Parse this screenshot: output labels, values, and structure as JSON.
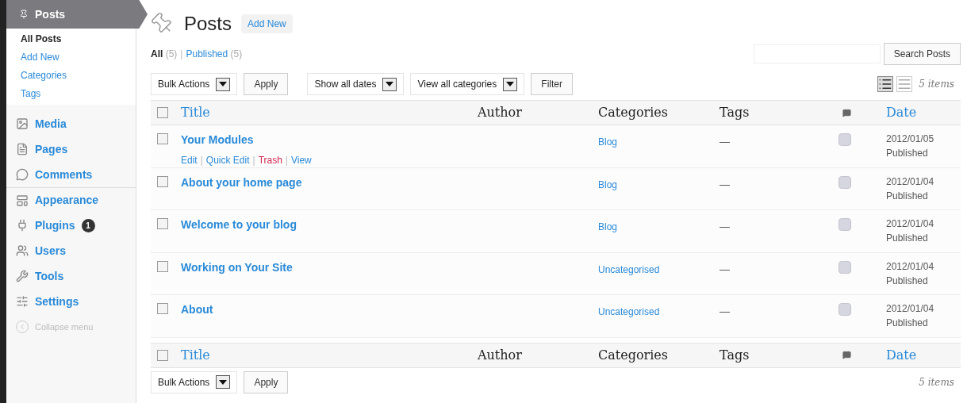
{
  "sidebar": {
    "current": {
      "label": "Posts"
    },
    "submenu": [
      {
        "label": "All Posts",
        "selected": true
      },
      {
        "label": "Add New",
        "selected": false
      },
      {
        "label": "Categories",
        "selected": false
      },
      {
        "label": "Tags",
        "selected": false
      }
    ],
    "items": [
      {
        "label": "Media"
      },
      {
        "label": "Pages"
      },
      {
        "label": "Comments"
      },
      {
        "label": "Appearance"
      },
      {
        "label": "Plugins",
        "badge": "1"
      },
      {
        "label": "Users"
      },
      {
        "label": "Tools"
      },
      {
        "label": "Settings"
      }
    ],
    "collapse": "Collapse menu"
  },
  "header": {
    "title": "Posts",
    "add_new": "Add New"
  },
  "filters": [
    {
      "label": "All",
      "count": "(5)",
      "selected": true
    },
    {
      "separator": "|",
      "label": "Published",
      "count": "(5)",
      "selected": false
    }
  ],
  "search": {
    "button": "Search Posts"
  },
  "toolbar": {
    "bulk": "Bulk Actions",
    "apply": "Apply",
    "dates": "Show all dates",
    "categories": "View all categories",
    "filter": "Filter"
  },
  "view_modes": [
    {
      "kind": "list",
      "selected": true
    },
    {
      "kind": "excerpt",
      "selected": false
    }
  ],
  "items_count": "5 items",
  "table_header": {
    "checked": false,
    "columns": [
      {
        "kind": "text",
        "label": "Title",
        "sortable": true
      },
      {
        "kind": "text",
        "label": "Author",
        "sortable": false
      },
      {
        "kind": "text",
        "label": "Categories",
        "sortable": false
      },
      {
        "kind": "text",
        "label": "Tags",
        "sortable": false
      },
      {
        "kind": "comments"
      },
      {
        "kind": "text",
        "label": "Date",
        "sortable": true
      }
    ]
  },
  "rows": [
    {
      "title": "Your Modules",
      "checked": false,
      "actions": [
        {
          "label": "Edit",
          "kind": "normal"
        },
        {
          "separator": "|",
          "label": "Quick Edit",
          "kind": "normal"
        },
        {
          "separator": "|",
          "label": "Trash",
          "kind": "danger"
        },
        {
          "separator": "|",
          "label": "View",
          "kind": "normal"
        }
      ],
      "category": "Blog",
      "tags": "—",
      "date": "2012/01/05",
      "status": "Published"
    },
    {
      "title": "About your home page",
      "checked": false,
      "category": "Blog",
      "tags": "—",
      "date": "2012/01/04",
      "status": "Published"
    },
    {
      "title": "Welcome to your blog",
      "checked": false,
      "category": "Blog",
      "tags": "—",
      "date": "2012/01/04",
      "status": "Published"
    },
    {
      "title": "Working on Your Site",
      "checked": false,
      "category": "Uncategorised",
      "tags": "—",
      "date": "2012/01/04",
      "status": "Published"
    },
    {
      "title": "About",
      "checked": false,
      "category": "Uncategorised",
      "tags": "—",
      "date": "2012/01/04",
      "status": "Published"
    }
  ],
  "table_footer": {
    "checked": false,
    "columns": [
      {
        "kind": "text",
        "label": "Title",
        "sortable": true
      },
      {
        "kind": "text",
        "label": "Author",
        "sortable": false
      },
      {
        "kind": "text",
        "label": "Categories",
        "sortable": false
      },
      {
        "kind": "text",
        "label": "Tags",
        "sortable": false
      },
      {
        "kind": "comments"
      },
      {
        "kind": "text",
        "label": "Date",
        "sortable": true
      }
    ]
  },
  "bottom_toolbar": {
    "bulk": "Bulk Actions",
    "apply": "Apply",
    "items_count": "5 items"
  }
}
